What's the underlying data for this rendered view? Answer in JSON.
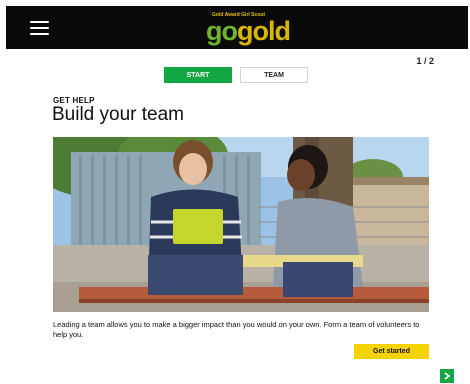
{
  "header": {
    "menu_icon": "hamburger-menu-icon",
    "logo_tagline": "Gold Award Girl Scout",
    "logo_text_1": "go",
    "logo_text_2": "gold"
  },
  "pagination": {
    "text": "1 / 2"
  },
  "tabs": [
    {
      "label": "START",
      "active": true
    },
    {
      "label": "TEAM",
      "active": false
    }
  ],
  "section": {
    "eyebrow": "GET HELP",
    "title": "Build your team"
  },
  "hero": {
    "alt": "two people sitting on a bench talking"
  },
  "caption": "Leading a team allows you to make a bigger impact than you would on your own. Form a team of volunteers to help you.",
  "cta": {
    "label": "Get started"
  },
  "nav": {
    "next_icon": "chevron-right-icon"
  },
  "colors": {
    "accent_green": "#13a644",
    "cta_yellow": "#f5d300",
    "header_bg": "#0a0a0a"
  }
}
